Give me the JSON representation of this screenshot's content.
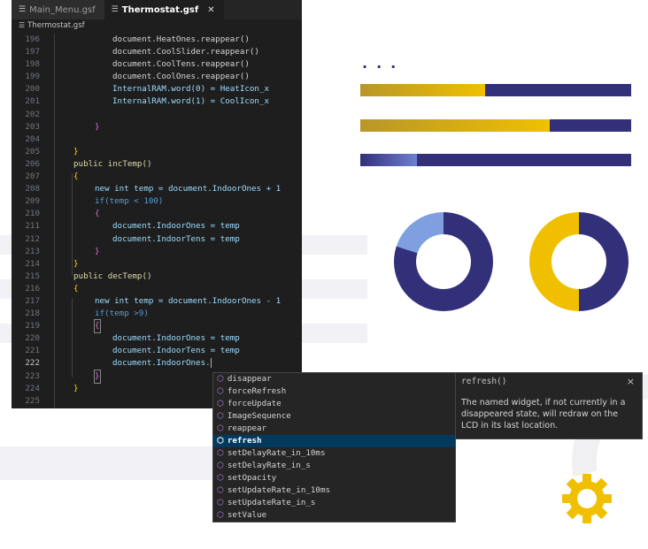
{
  "tabs": [
    {
      "label": "Main_Menu.gsf",
      "active": false
    },
    {
      "label": "Thermostat.gsf",
      "active": true,
      "close": "✕"
    }
  ],
  "breadcrumb": "Thermostat.gsf",
  "lines": [
    {
      "n": "196"
    },
    {
      "n": "197"
    },
    {
      "n": "198"
    },
    {
      "n": "199"
    },
    {
      "n": "200"
    },
    {
      "n": "201"
    },
    {
      "n": "202"
    },
    {
      "n": "203"
    },
    {
      "n": "204"
    },
    {
      "n": "205"
    },
    {
      "n": "206"
    },
    {
      "n": "207"
    },
    {
      "n": "208"
    },
    {
      "n": "209"
    },
    {
      "n": "210"
    },
    {
      "n": "211"
    },
    {
      "n": "212"
    },
    {
      "n": "213"
    },
    {
      "n": "214"
    },
    {
      "n": "215"
    },
    {
      "n": "216"
    },
    {
      "n": "217"
    },
    {
      "n": "218"
    },
    {
      "n": "219"
    },
    {
      "n": "220"
    },
    {
      "n": "221"
    },
    {
      "n": "222"
    },
    {
      "n": "223"
    },
    {
      "n": "224"
    },
    {
      "n": "225"
    }
  ],
  "code": {
    "l196": "document.HeatOnes.reappear()",
    "l197": "document.CoolSlider.reappear()",
    "l198": "document.CoolTens.reappear()",
    "l199": "document.CoolOnes.reappear()",
    "l200": "InternalRAM.word(0) = HeatIcon_x",
    "l201": "InternalRAM.word(1) = CoolIcon_x",
    "l203": "}",
    "l205": "}",
    "l206": "public incTemp()",
    "l207": "{",
    "l208": "new int temp = document.IndoorOnes + 1",
    "l209": "if(temp < 100)",
    "l210": "{",
    "l211": "document.IndoorOnes = temp",
    "l212": "document.IndoorTens = temp",
    "l213": "}",
    "l214": "}",
    "l215": "public decTemp()",
    "l216": "{",
    "l217": "new int temp = document.IndoorOnes - 1",
    "l218": "if(temp >9)",
    "l219": "{",
    "l220": "document.IndoorOnes = temp",
    "l221": "document.IndoorTens = temp",
    "l222": "document.IndoorOnes.",
    "l223": "}",
    "l224": "}"
  },
  "suggestions": [
    {
      "label": "disappear"
    },
    {
      "label": "forceRefresh"
    },
    {
      "label": "forceUpdate"
    },
    {
      "label": "ImageSequence"
    },
    {
      "label": "reappear"
    },
    {
      "label": "refresh",
      "selected": true
    },
    {
      "label": "setDelayRate_in_10ms"
    },
    {
      "label": "setDelayRate_in_s"
    },
    {
      "label": "setOpacity"
    },
    {
      "label": "setUpdateRate_in_10ms"
    },
    {
      "label": "setUpdateRate_in_s"
    },
    {
      "label": "setValue"
    }
  ],
  "detail": {
    "title": "refresh()",
    "close": "×",
    "text": "The named widget, if not currently in a disappeared state, will redraw on the LCD in its last location."
  },
  "illustration": {
    "dots": "...",
    "bars": [
      {
        "fill_fraction": 0.46,
        "fill_from": "#b8962a",
        "fill_to": "#f0c000"
      },
      {
        "fill_fraction": 0.7,
        "fill_from": "#b8962a",
        "fill_to": "#f0c000"
      },
      {
        "fill_fraction": 0.21,
        "fill_from": "#33307a",
        "fill_to": "#6f7fd0"
      }
    ],
    "donuts": [
      {
        "fill_fraction": 0.2,
        "accent": "#7f9fe0"
      },
      {
        "fill_fraction": 0.5,
        "accent": "#f0c000"
      }
    ],
    "colors": {
      "navy": "#33307a",
      "gold": "#f0c000"
    }
  }
}
